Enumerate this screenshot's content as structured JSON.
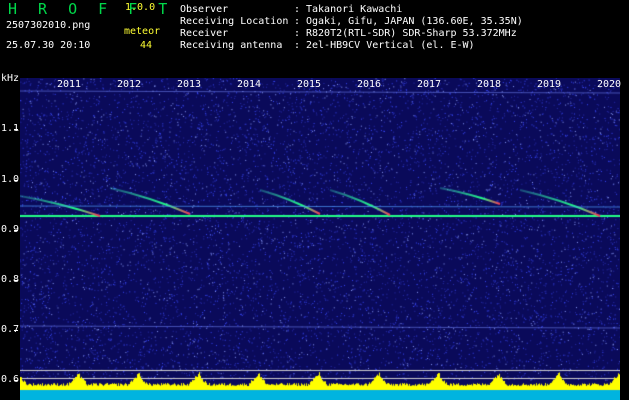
{
  "header": {
    "app_title": "H R O F F T",
    "app_version": "1.0.0",
    "filename": "2507302010.png",
    "timestamp": "25.07.30 20:10",
    "meteor_label": "meteor",
    "meteor_count": "44"
  },
  "info": [
    {
      "key": "Observer",
      "value": "Takanori Kawachi"
    },
    {
      "key": "Receiving Location",
      "value": "Ogaki, Gifu, JAPAN (136.60E, 35.35N)"
    },
    {
      "key": "Receiver",
      "value": "R820T2(RTL-SDR) SDR-Sharp 53.372MHz"
    },
    {
      "key": "Receiving antenna",
      "value": "2el-HB9CV Vertical (el. E-W)"
    }
  ],
  "spectrogram": {
    "y_unit": "kHz",
    "y_ticks": [
      "1.1",
      "1.0",
      "0.9",
      "0.8",
      "0.7",
      "0.6"
    ],
    "x_labels": [
      "2011",
      "2012",
      "2013",
      "2014",
      "2015",
      "2016",
      "2017",
      "2018",
      "2019",
      "2020"
    ],
    "colors": {
      "background": "#0a0a5a",
      "noise": "#3a4aff",
      "signal": "#22ff88",
      "hot": "#ff3355",
      "bars": "#ffff00",
      "base": "#00b4e0"
    }
  }
}
